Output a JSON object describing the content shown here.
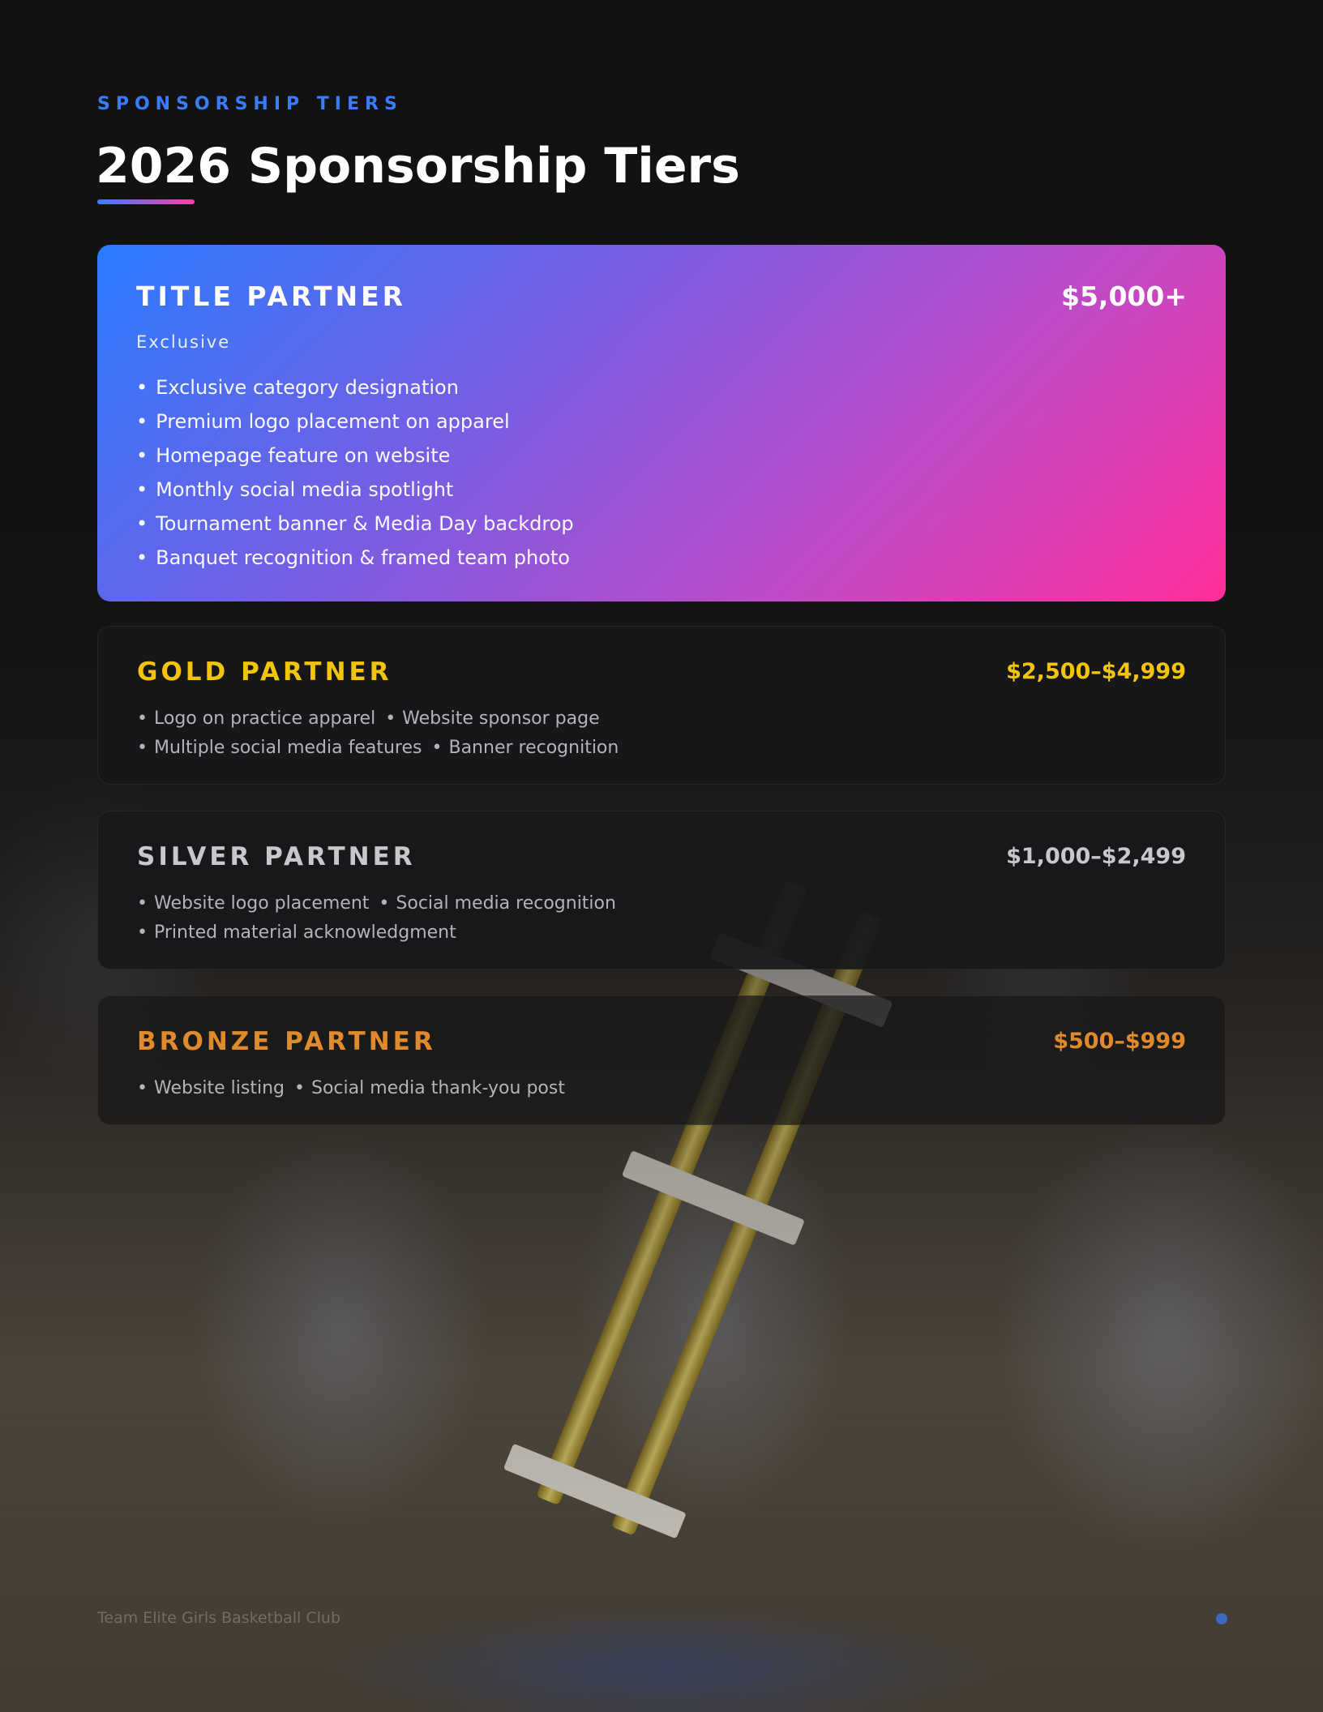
{
  "brand": {
    "accent_blue": "#3b7cff",
    "accent_pink": "#ff3da8",
    "gold": "#f2c40d",
    "silver": "#c8c8cc",
    "bronze": "#e08a2e"
  },
  "header": {
    "eyebrow": "SPONSORSHIP TIERS",
    "title": "2026 Sponsorship Tiers"
  },
  "tiers": [
    {
      "name": "TITLE PARTNER",
      "price": "$5,000+",
      "subtitle": "Exclusive",
      "benefits": [
        "Exclusive category designation",
        "Premium logo placement on apparel",
        "Homepage feature on website",
        "Monthly social media spotlight",
        "Tournament banner & Media Day backdrop",
        "Banquet recognition & framed team photo"
      ]
    },
    {
      "name": "GOLD PARTNER",
      "price": "$2,500–$4,999",
      "lines": [
        [
          "Logo on practice apparel",
          "Website sponsor page"
        ],
        [
          "Multiple social media features",
          "Banner recognition"
        ]
      ]
    },
    {
      "name": "SILVER PARTNER",
      "price": "$1,000–$2,499",
      "lines": [
        [
          "Website logo placement",
          "Social media recognition"
        ],
        [
          "Printed material acknowledgment"
        ]
      ]
    },
    {
      "name": "BRONZE PARTNER",
      "price": "$500–$999",
      "lines": [
        [
          "Website listing",
          "Social media thank-you post"
        ]
      ]
    }
  ],
  "footer": {
    "club_name": "Team Elite Girls Basketball Club"
  }
}
